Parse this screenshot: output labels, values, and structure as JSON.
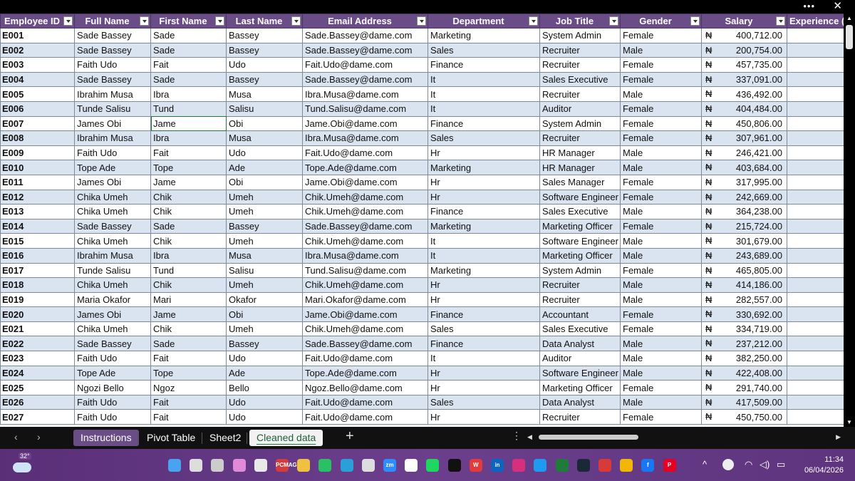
{
  "window": {
    "more_label": "•••",
    "close_label": "✕"
  },
  "columns": [
    "Employee ID",
    "Full Name",
    "First Name",
    "Last Name",
    "Email Address",
    "Department",
    "Job Title",
    "Gender",
    "Salary",
    "Experience (Y"
  ],
  "currency_symbol": "₦",
  "rows": [
    [
      "E001",
      "Sade Bassey",
      "Sade",
      "Bassey",
      "Sade.Bassey@dame.com",
      "Marketing",
      "System Admin",
      "Female",
      "400,712.00"
    ],
    [
      "E002",
      "Sade Bassey",
      "Sade",
      "Bassey",
      "Sade.Bassey@dame.com",
      "Sales",
      "Recruiter",
      "Male",
      "200,754.00"
    ],
    [
      "E003",
      "Faith Udo",
      "Fait",
      "Udo",
      "Fait.Udo@dame.com",
      "Finance",
      "Recruiter",
      "Female",
      "457,735.00"
    ],
    [
      "E004",
      "Sade Bassey",
      "Sade",
      "Bassey",
      "Sade.Bassey@dame.com",
      "It",
      "Sales Executive",
      "Female",
      "337,091.00"
    ],
    [
      "E005",
      "Ibrahim Musa",
      "Ibra",
      "Musa",
      "Ibra.Musa@dame.com",
      "It",
      "Recruiter",
      "Male",
      "436,492.00"
    ],
    [
      "E006",
      "Tunde Salisu",
      "Tund",
      "Salisu",
      "Tund.Salisu@dame.com",
      "It",
      "Auditor",
      "Female",
      "404,484.00"
    ],
    [
      "E007",
      "James Obi",
      "Jame",
      "Obi",
      "Jame.Obi@dame.com",
      "Finance",
      "System Admin",
      "Female",
      "450,806.00"
    ],
    [
      "E008",
      "Ibrahim Musa",
      "Ibra",
      "Musa",
      "Ibra.Musa@dame.com",
      "Sales",
      "Recruiter",
      "Female",
      "307,961.00"
    ],
    [
      "E009",
      "Faith Udo",
      "Fait",
      "Udo",
      "Fait.Udo@dame.com",
      "Hr",
      "HR Manager",
      "Male",
      "246,421.00"
    ],
    [
      "E010",
      "Tope Ade",
      "Tope",
      "Ade",
      "Tope.Ade@dame.com",
      "Marketing",
      "HR Manager",
      "Male",
      "403,684.00"
    ],
    [
      "E011",
      "James Obi",
      "Jame",
      "Obi",
      "Jame.Obi@dame.com",
      "Hr",
      "Sales Manager",
      "Female",
      "317,995.00"
    ],
    [
      "E012",
      "Chika Umeh",
      "Chik",
      "Umeh",
      "Chik.Umeh@dame.com",
      "Hr",
      "Software Engineer",
      "Female",
      "242,669.00"
    ],
    [
      "E013",
      "Chika Umeh",
      "Chik",
      "Umeh",
      "Chik.Umeh@dame.com",
      "Finance",
      "Sales Executive",
      "Male",
      "364,238.00"
    ],
    [
      "E014",
      "Sade Bassey",
      "Sade",
      "Bassey",
      "Sade.Bassey@dame.com",
      "Marketing",
      "Marketing Officer",
      "Female",
      "215,724.00"
    ],
    [
      "E015",
      "Chika Umeh",
      "Chik",
      "Umeh",
      "Chik.Umeh@dame.com",
      "It",
      "Software Engineer",
      "Male",
      "301,679.00"
    ],
    [
      "E016",
      "Ibrahim Musa",
      "Ibra",
      "Musa",
      "Ibra.Musa@dame.com",
      "It",
      "Marketing Officer",
      "Male",
      "243,689.00"
    ],
    [
      "E017",
      "Tunde Salisu",
      "Tund",
      "Salisu",
      "Tund.Salisu@dame.com",
      "Marketing",
      "System Admin",
      "Female",
      "465,805.00"
    ],
    [
      "E018",
      "Chika Umeh",
      "Chik",
      "Umeh",
      "Chik.Umeh@dame.com",
      "Hr",
      "Recruiter",
      "Male",
      "414,186.00"
    ],
    [
      "E019",
      "Maria Okafor",
      "Mari",
      "Okafor",
      "Mari.Okafor@dame.com",
      "Hr",
      "Recruiter",
      "Male",
      "282,557.00"
    ],
    [
      "E020",
      "James Obi",
      "Jame",
      "Obi",
      "Jame.Obi@dame.com",
      "Finance",
      "Accountant",
      "Female",
      "330,692.00"
    ],
    [
      "E021",
      "Chika Umeh",
      "Chik",
      "Umeh",
      "Chik.Umeh@dame.com",
      "Sales",
      "Sales Executive",
      "Female",
      "334,719.00"
    ],
    [
      "E022",
      "Sade Bassey",
      "Sade",
      "Bassey",
      "Sade.Bassey@dame.com",
      "Finance",
      "Data Analyst",
      "Male",
      "237,212.00"
    ],
    [
      "E023",
      "Faith Udo",
      "Fait",
      "Udo",
      "Fait.Udo@dame.com",
      "It",
      "Auditor",
      "Male",
      "382,250.00"
    ],
    [
      "E024",
      "Tope Ade",
      "Tope",
      "Ade",
      "Tope.Ade@dame.com",
      "Hr",
      "Software Engineer",
      "Male",
      "422,408.00"
    ],
    [
      "E025",
      "Ngozi Bello",
      "Ngoz",
      "Bello",
      "Ngoz.Bello@dame.com",
      "Hr",
      "Marketing Officer",
      "Female",
      "291,740.00"
    ],
    [
      "E026",
      "Faith Udo",
      "Fait",
      "Udo",
      "Fait.Udo@dame.com",
      "Sales",
      "Data Analyst",
      "Male",
      "417,509.00"
    ],
    [
      "E027",
      "Faith Udo",
      "Fait",
      "Udo",
      "Fait.Udo@dame.com",
      "Hr",
      "Recruiter",
      "Female",
      "450,750.00"
    ]
  ],
  "selected_cell": {
    "row": 6,
    "col": 2
  },
  "sheet_tabs": [
    {
      "label": "Instructions",
      "state": "colored"
    },
    {
      "label": "Pivot Table",
      "state": "normal"
    },
    {
      "label": "Sheet2",
      "state": "normal"
    },
    {
      "label": "Cleaned data",
      "state": "active"
    }
  ],
  "nav": {
    "prev": "‹",
    "next": "›",
    "add": "+",
    "options": "⋮",
    "scroll_left": "◀",
    "scroll_right": "▶",
    "scroll_up": "▲",
    "scroll_down": "▼"
  },
  "taskbar": {
    "weather_temp": "32°",
    "apps": [
      {
        "name": "windows-start",
        "label": "",
        "color": "#4aa3f0"
      },
      {
        "name": "search",
        "label": "",
        "color": "#dddddd"
      },
      {
        "name": "task-view",
        "label": "",
        "color": "#cccccc"
      },
      {
        "name": "copilot",
        "label": "",
        "color": "#e08ad8"
      },
      {
        "name": "widgets-news",
        "label": "",
        "color": "#e9e9e9"
      },
      {
        "name": "pcmag",
        "label": "PCMAG",
        "color": "#d43b3b"
      },
      {
        "name": "file-explorer",
        "label": "",
        "color": "#f0c040"
      },
      {
        "name": "whatsapp",
        "label": "",
        "color": "#29c163"
      },
      {
        "name": "edge",
        "label": "",
        "color": "#2b9fd8"
      },
      {
        "name": "mail",
        "label": "",
        "color": "#dddddd"
      },
      {
        "name": "zoom",
        "label": "zm",
        "color": "#2d8cff"
      },
      {
        "name": "chatgpt",
        "label": "",
        "color": "#ffffff"
      },
      {
        "name": "spotify",
        "label": "",
        "color": "#1ed760"
      },
      {
        "name": "tiktok",
        "label": "",
        "color": "#111111"
      },
      {
        "name": "wps",
        "label": "W",
        "color": "#e33b3b"
      },
      {
        "name": "linkedin",
        "label": "in",
        "color": "#0a66c2"
      },
      {
        "name": "instagram",
        "label": "",
        "color": "#d6307d"
      },
      {
        "name": "twitter",
        "label": "",
        "color": "#1d9bf0"
      },
      {
        "name": "excel",
        "label": "",
        "color": "#1f7a3c"
      },
      {
        "name": "steam",
        "label": "",
        "color": "#1b2838"
      },
      {
        "name": "roblox",
        "label": "",
        "color": "#d83a3a"
      },
      {
        "name": "chrome",
        "label": "",
        "color": "#f2b705"
      },
      {
        "name": "facebook",
        "label": "f",
        "color": "#1877f2"
      },
      {
        "name": "pinterest",
        "label": "P",
        "color": "#e60023"
      }
    ],
    "tray": {
      "chevron": "^",
      "wifi": "◠",
      "volume": "◁)",
      "battery": "▭"
    },
    "time": "11:34",
    "date": "06/04/2026"
  }
}
